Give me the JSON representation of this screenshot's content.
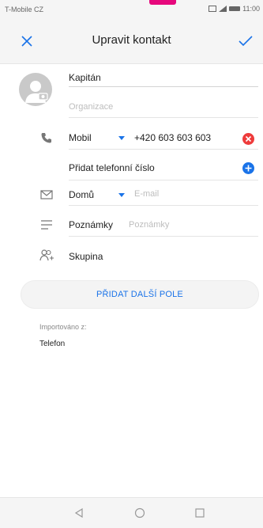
{
  "status_bar": {
    "carrier": "T-Mobile CZ",
    "time": "11:00"
  },
  "header": {
    "title": "Upravit kontakt",
    "close_icon": "close-icon",
    "save_icon": "check-icon"
  },
  "contact": {
    "name": "Kapitán",
    "organization_placeholder": "Organizace"
  },
  "phone": {
    "type_label": "Mobil",
    "number": "+420 603 603 603",
    "add_label": "Přidat telefonní číslo"
  },
  "email": {
    "type_label": "Domů",
    "placeholder": "E-mail"
  },
  "notes": {
    "label": "Poznámky",
    "placeholder": "Poznámky"
  },
  "group": {
    "label": "Skupina"
  },
  "add_field_button": "PŘIDAT DALŠÍ POLE",
  "import": {
    "label": "Importováno z:",
    "value": "Telefon"
  },
  "colors": {
    "accent": "#1a73e8",
    "remove": "#ee3b3b",
    "brand_tab": "#e6087c"
  }
}
